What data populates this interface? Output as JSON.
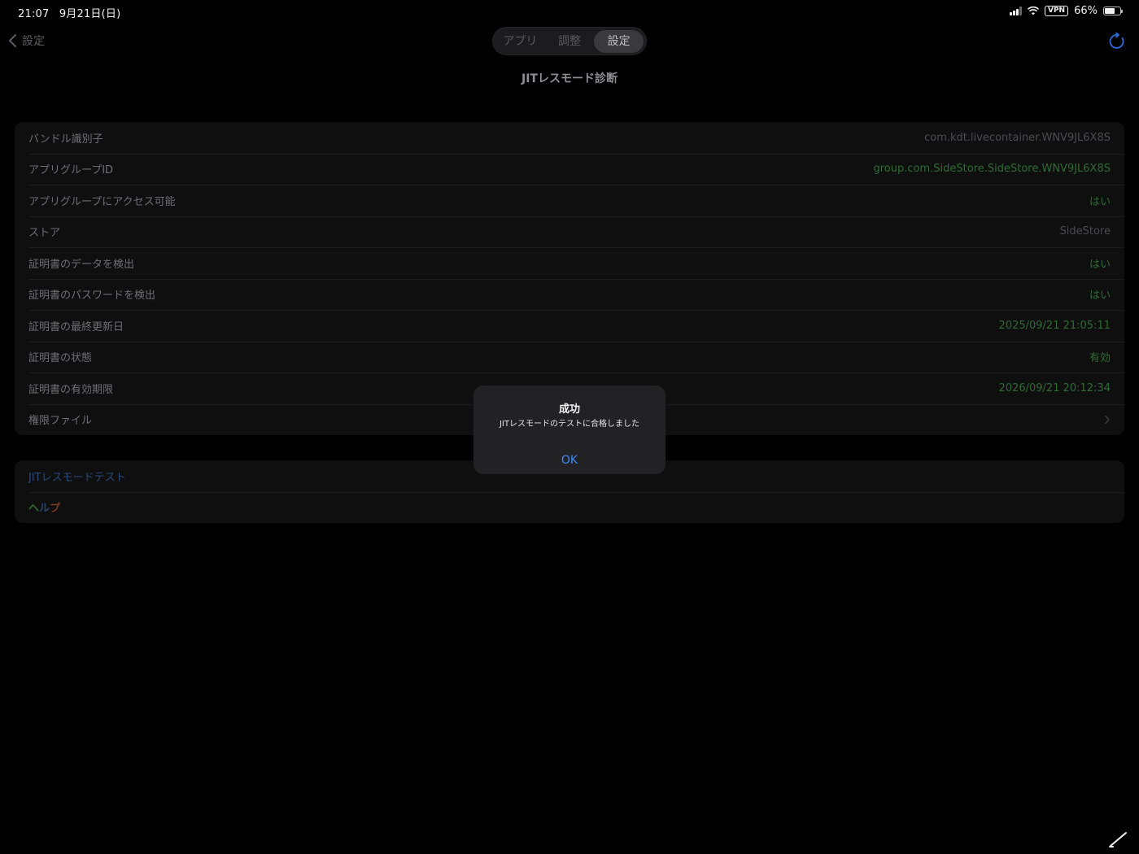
{
  "status_bar": {
    "time": "21:07",
    "date": "9月21日(日)",
    "vpn": "VPN",
    "battery": "66%",
    "battery_level": 0.66
  },
  "nav": {
    "back_label": "設定",
    "segments": [
      "アプリ",
      "調整",
      "設定"
    ],
    "selected_segment": "設定",
    "title": "JITレスモード診断"
  },
  "diagnostics": {
    "rows": [
      {
        "label": "バンドル識別子",
        "value": "com.kdt.livecontainer.WNV9JL6X8S"
      },
      {
        "label": "アプリグループID",
        "value": "group.com.SideStore.SideStore.WNV9JL6X8S"
      },
      {
        "label": "アプリグループにアクセス可能",
        "value": "はい"
      },
      {
        "label": "ストア",
        "value": "SideStore"
      },
      {
        "label": "証明書のデータを検出",
        "value": "はい"
      },
      {
        "label": "証明書のパスワードを検出",
        "value": "はい"
      },
      {
        "label": "証明書の最終更新日",
        "value": "2025/09/21 21:05:11"
      },
      {
        "label": "証明書の状態",
        "value": "有効"
      },
      {
        "label": "証明書の有効期限",
        "value": "2026/09/21 20:12:34"
      },
      {
        "label": "権限ファイル",
        "value": ""
      }
    ]
  },
  "actions": {
    "test_label": "JITレスモードテスト",
    "help_label": "ヘルプ"
  },
  "alert": {
    "title": "成功",
    "message": "JITレスモードのテストに合格しました",
    "ok_label": "OK"
  },
  "colors": {
    "background": "#000000",
    "accent_blue": "#3d8bff",
    "success_green": "#2f6b33"
  }
}
